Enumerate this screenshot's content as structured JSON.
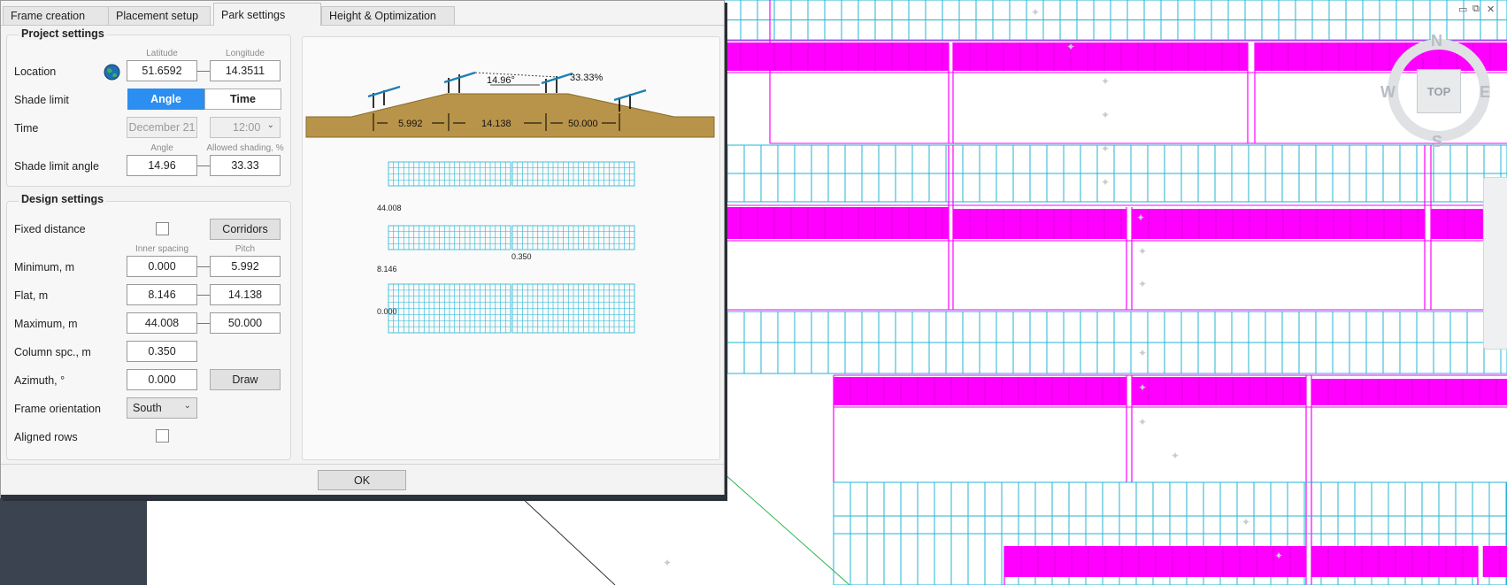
{
  "tabs": [
    {
      "label": "Frame creation"
    },
    {
      "label": "Placement setup"
    },
    {
      "label": "Park settings"
    },
    {
      "label": "Height & Optimization"
    }
  ],
  "project": {
    "title": "Project settings",
    "latitude_caption": "Latitude",
    "longitude_caption": "Longitude",
    "location_label": "Location",
    "latitude": "51.6592",
    "longitude": "14.3511",
    "shade_limit_label": "Shade limit",
    "shade_angle_btn": "Angle",
    "shade_time_btn": "Time",
    "time_label": "Time",
    "time_date": "December 21",
    "time_hour": "12:00",
    "angle_caption": "Angle",
    "allowed_caption": "Allowed shading, %",
    "shade_limit_angle_label": "Shade limit angle",
    "shade_angle": "14.96",
    "allowed_shading": "33.33"
  },
  "design": {
    "title": "Design settings",
    "fixed_distance_label": "Fixed distance",
    "corridors_btn": "Corridors",
    "inner_spacing_caption": "Inner spacing",
    "pitch_caption": "Pitch",
    "minimum_label": "Minimum, m",
    "min_inner": "0.000",
    "min_pitch": "5.992",
    "flat_label": "Flat, m",
    "flat_inner": "8.146",
    "flat_pitch": "14.138",
    "maximum_label": "Maximum, m",
    "max_inner": "44.008",
    "max_pitch": "50.000",
    "column_label": "Column spc., m",
    "column_value": "0.350",
    "azimuth_label": "Azimuth, °",
    "azimuth_value": "0.000",
    "draw_btn": "Draw",
    "orientation_label": "Frame orientation",
    "orientation_value": "South",
    "aligned_label": "Aligned rows"
  },
  "preview": {
    "angle_text": "14.96°",
    "percent_text": "33.33%",
    "dim1": "5.992",
    "dim2": "14.138",
    "dim3": "50.000",
    "row_label_1": "44.008",
    "row_label_2": "0.350",
    "row_label_3": "8.146",
    "row_label_4": "0.000"
  },
  "ok_label": "OK",
  "viewcube": {
    "n": "N",
    "s": "S",
    "w": "W",
    "e": "E",
    "top": "TOP"
  },
  "colors": {
    "accent": "#2b8ef0",
    "magenta": "#ff00ff",
    "cyan": "#20b4d4",
    "ground": "#b8944a"
  }
}
